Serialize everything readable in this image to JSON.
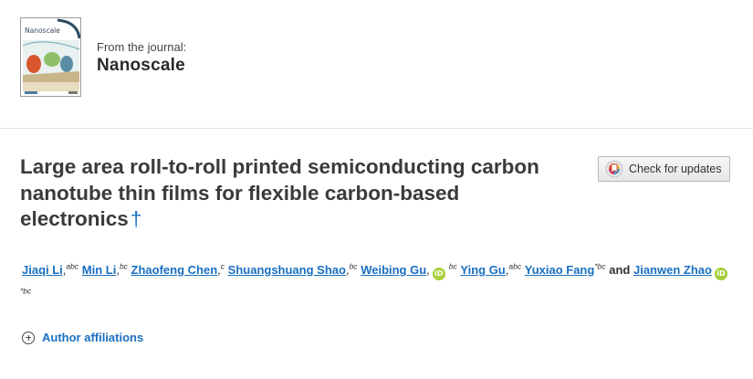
{
  "journal": {
    "cover_title": "Nanoscale",
    "from_label": "From the journal:",
    "name": "Nanoscale"
  },
  "article": {
    "title": "Large area roll-to-roll printed semiconducting carbon nanotube thin films for flexible carbon-based electronics",
    "dagger": "†"
  },
  "check_updates": {
    "label": "Check for updates"
  },
  "authors": [
    {
      "name": "Jiaqi Li",
      "aff": "abc",
      "orcid": false,
      "corresponding": false
    },
    {
      "name": "Min Li",
      "aff": "bc",
      "orcid": false,
      "corresponding": false
    },
    {
      "name": "Zhaofeng Chen",
      "aff": "c",
      "orcid": false,
      "corresponding": false
    },
    {
      "name": "Shuangshuang Shao",
      "aff": "bc",
      "orcid": false,
      "corresponding": false
    },
    {
      "name": "Weibing Gu",
      "aff": "bc",
      "orcid": true,
      "corresponding": false
    },
    {
      "name": "Ying Gu",
      "aff": "abc",
      "orcid": false,
      "corresponding": false
    },
    {
      "name": "Yuxiao Fang",
      "aff": "*bc",
      "orcid": false,
      "corresponding": true
    },
    {
      "name": "Jianwen Zhao",
      "aff": "*bc",
      "orcid": true,
      "corresponding": true
    }
  ],
  "authors_text": {
    "and": "and",
    "separator": ","
  },
  "affiliations": {
    "label": "Author affiliations"
  },
  "colors": {
    "link": "#1a6fc0",
    "orcid": "#a6ce39",
    "title": "#3a3a3a"
  },
  "icons": {
    "check_updates": "crossmark-icon",
    "affiliations": "plus-circle-icon",
    "orcid": "orcid-icon"
  }
}
